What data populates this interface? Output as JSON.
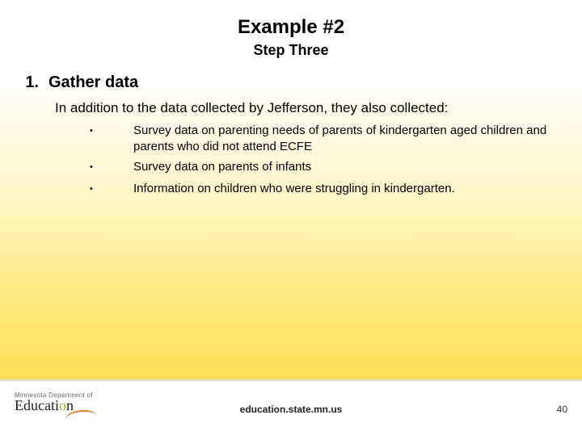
{
  "title": "Example #2",
  "subtitle": "Step Three",
  "list_number": "1.",
  "list_heading": "Gather data",
  "intro": "In addition to the data collected by Jefferson, they also collected:",
  "bullets": [
    "Survey data on parenting needs of parents of kindergarten aged children and parents who did not attend ECFE",
    "Survey data on parents of infants",
    "Information on children who were struggling in kindergarten."
  ],
  "footer_url": "education.state.mn.us",
  "page_number": "40",
  "logo_top": "Minnesota Department of",
  "logo_main_prefix": "Educati",
  "logo_main_accent": "o",
  "logo_main_suffix": "n"
}
